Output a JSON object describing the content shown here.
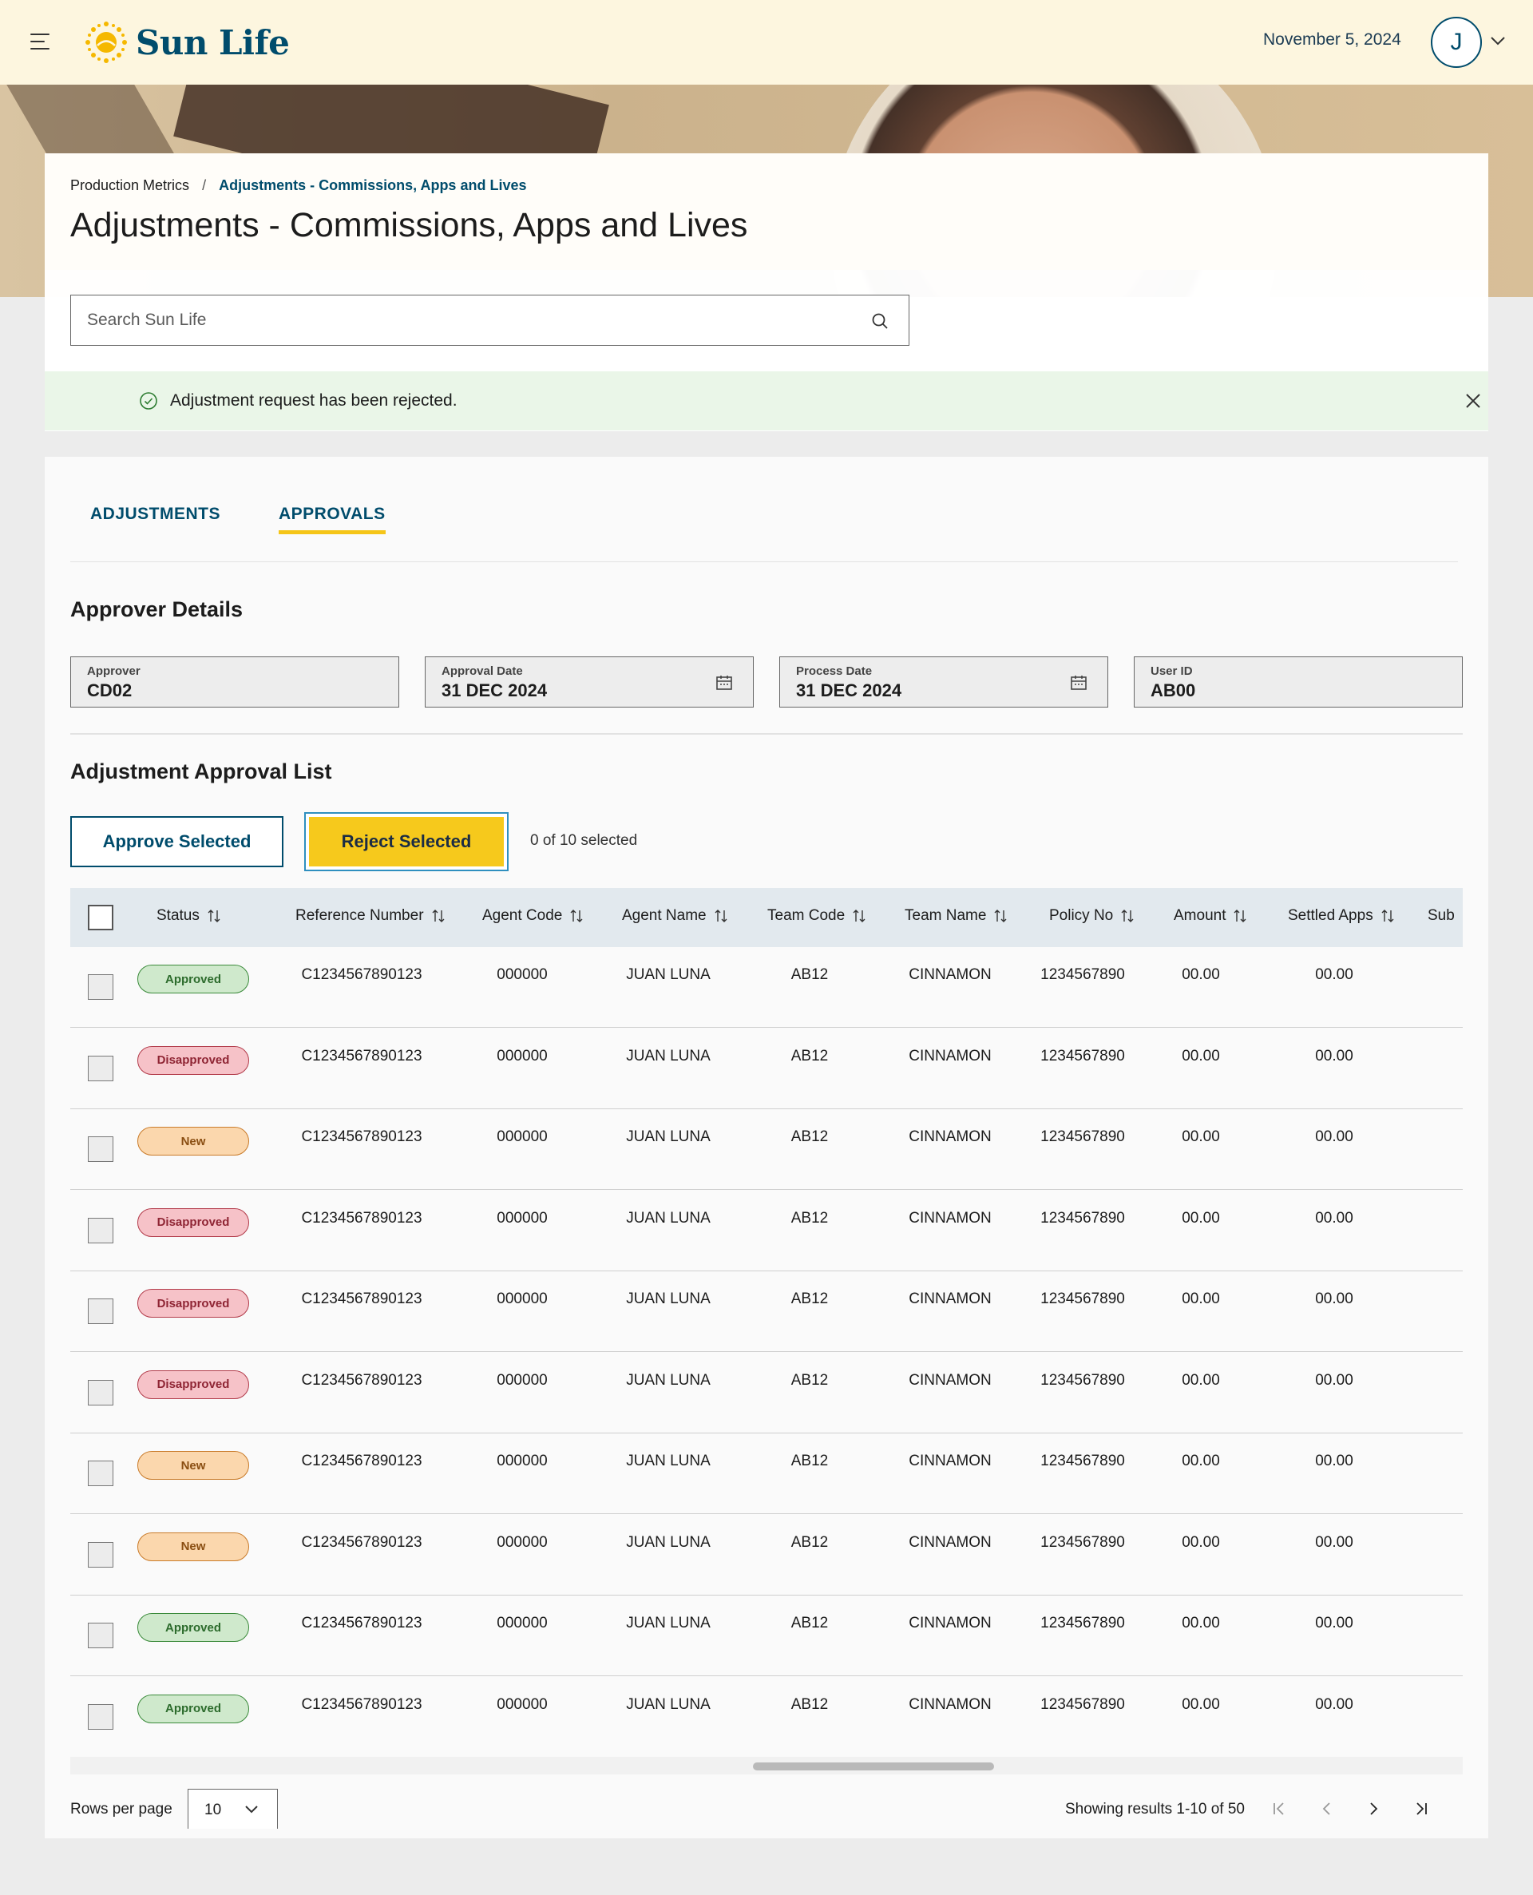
{
  "header": {
    "brand": "Sun Life",
    "date": "November 5, 2024",
    "avatar_initial": "J"
  },
  "breadcrumb": {
    "parent": "Production Metrics",
    "separator": "/",
    "current": "Adjustments - Commissions, Apps and Lives"
  },
  "page_title": "Adjustments - Commissions, Apps and Lives",
  "search": {
    "placeholder": "Search Sun Life"
  },
  "toast": {
    "message": "Adjustment request has been rejected."
  },
  "tabs": [
    {
      "label": "ADJUSTMENTS",
      "active": false
    },
    {
      "label": "APPROVALS",
      "active": true
    }
  ],
  "approver_details": {
    "heading": "Approver Details",
    "fields": [
      {
        "label": "Approver",
        "value": "CD02"
      },
      {
        "label": "Approval Date",
        "value": "31 DEC 2024"
      },
      {
        "label": "Process Date",
        "value": "31 DEC 2024"
      },
      {
        "label": "User ID",
        "value": "AB00"
      }
    ]
  },
  "approval_list": {
    "heading": "Adjustment Approval List",
    "approve_label": "Approve Selected",
    "reject_label": "Reject Selected",
    "selected_text": "0 of 10 selected"
  },
  "table": {
    "columns": [
      "Status",
      "Reference Number",
      "Agent Code",
      "Agent Name",
      "Team Code",
      "Team Name",
      "Policy No",
      "Amount",
      "Settled Apps",
      "Sub"
    ],
    "rows": [
      {
        "status": "Approved",
        "ref": "C1234567890123",
        "agent_code": "000000",
        "agent_name": "JUAN LUNA",
        "team_code": "AB12",
        "team_name": "CINNAMON",
        "policy_no": "1234567890",
        "amount": "00.00",
        "settled_apps": "00.00"
      },
      {
        "status": "Disapproved",
        "ref": "C1234567890123",
        "agent_code": "000000",
        "agent_name": "JUAN LUNA",
        "team_code": "AB12",
        "team_name": "CINNAMON",
        "policy_no": "1234567890",
        "amount": "00.00",
        "settled_apps": "00.00"
      },
      {
        "status": "New",
        "ref": "C1234567890123",
        "agent_code": "000000",
        "agent_name": "JUAN LUNA",
        "team_code": "AB12",
        "team_name": "CINNAMON",
        "policy_no": "1234567890",
        "amount": "00.00",
        "settled_apps": "00.00"
      },
      {
        "status": "Disapproved",
        "ref": "C1234567890123",
        "agent_code": "000000",
        "agent_name": "JUAN LUNA",
        "team_code": "AB12",
        "team_name": "CINNAMON",
        "policy_no": "1234567890",
        "amount": "00.00",
        "settled_apps": "00.00"
      },
      {
        "status": "Disapproved",
        "ref": "C1234567890123",
        "agent_code": "000000",
        "agent_name": "JUAN LUNA",
        "team_code": "AB12",
        "team_name": "CINNAMON",
        "policy_no": "1234567890",
        "amount": "00.00",
        "settled_apps": "00.00"
      },
      {
        "status": "Disapproved",
        "ref": "C1234567890123",
        "agent_code": "000000",
        "agent_name": "JUAN LUNA",
        "team_code": "AB12",
        "team_name": "CINNAMON",
        "policy_no": "1234567890",
        "amount": "00.00",
        "settled_apps": "00.00"
      },
      {
        "status": "New",
        "ref": "C1234567890123",
        "agent_code": "000000",
        "agent_name": "JUAN LUNA",
        "team_code": "AB12",
        "team_name": "CINNAMON",
        "policy_no": "1234567890",
        "amount": "00.00",
        "settled_apps": "00.00"
      },
      {
        "status": "New",
        "ref": "C1234567890123",
        "agent_code": "000000",
        "agent_name": "JUAN LUNA",
        "team_code": "AB12",
        "team_name": "CINNAMON",
        "policy_no": "1234567890",
        "amount": "00.00",
        "settled_apps": "00.00"
      },
      {
        "status": "Approved",
        "ref": "C1234567890123",
        "agent_code": "000000",
        "agent_name": "JUAN LUNA",
        "team_code": "AB12",
        "team_name": "CINNAMON",
        "policy_no": "1234567890",
        "amount": "00.00",
        "settled_apps": "00.00"
      },
      {
        "status": "Approved",
        "ref": "C1234567890123",
        "agent_code": "000000",
        "agent_name": "JUAN LUNA",
        "team_code": "AB12",
        "team_name": "CINNAMON",
        "policy_no": "1234567890",
        "amount": "00.00",
        "settled_apps": "00.00"
      }
    ]
  },
  "pagination": {
    "rows_per_page_label": "Rows per page",
    "rows_per_page_value": "10",
    "showing_text": "Showing results 1-10 of 50"
  },
  "colors": {
    "brand_blue": "#004c6c",
    "accent_yellow": "#f6c91c",
    "header_bg": "#fdf6df",
    "toast_bg": "#eaf6e8"
  },
  "icons": [
    "hamburger-icon",
    "sun-logo-icon",
    "chevron-down-icon",
    "search-icon",
    "check-circle-icon",
    "close-icon",
    "calendar-icon",
    "sort-icon",
    "first-page-icon",
    "prev-page-icon",
    "next-page-icon",
    "last-page-icon"
  ]
}
